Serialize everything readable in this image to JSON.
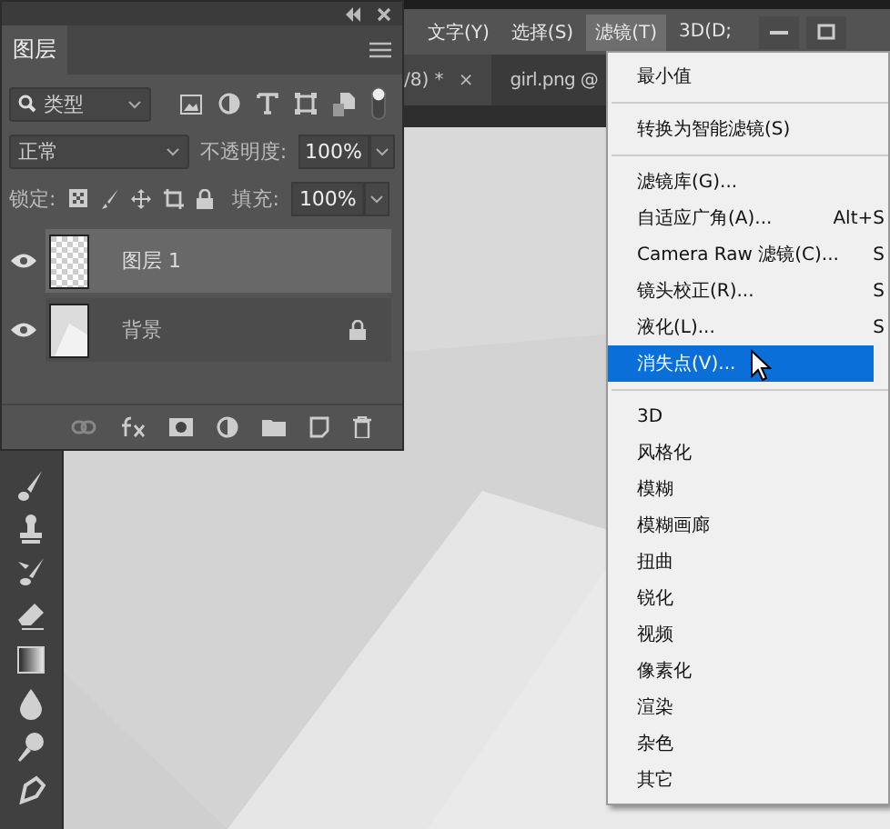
{
  "menubar": {
    "items": [
      {
        "label": "文字(Y)",
        "selected": false
      },
      {
        "label": "选择(S)",
        "selected": false
      },
      {
        "label": "滤镜(T)",
        "selected": true
      },
      {
        "label": "3D(D;",
        "selected": false
      }
    ]
  },
  "tabs": [
    {
      "label": "/8) *",
      "close": "×"
    },
    {
      "label": "girl.png @"
    }
  ],
  "layers_panel": {
    "title": "图层",
    "filter": {
      "value": "类型"
    },
    "blend_mode": {
      "value": "正常"
    },
    "opacity": {
      "label": "不透明度:",
      "value": "100%"
    },
    "lock_label": "锁定:",
    "fill": {
      "label": "填充:",
      "value": "100%"
    },
    "layers": [
      {
        "name": "图层 1",
        "selected": true,
        "visible": true,
        "locked": false,
        "kind": "transparent"
      },
      {
        "name": "背景",
        "selected": false,
        "visible": true,
        "locked": true,
        "kind": "background"
      }
    ]
  },
  "filter_menu": {
    "items": [
      {
        "kind": "item",
        "label": "最小值",
        "selected": false
      },
      {
        "kind": "separator"
      },
      {
        "kind": "item",
        "label": "转换为智能滤镜(S)",
        "selected": false
      },
      {
        "kind": "separator"
      },
      {
        "kind": "item",
        "label": "滤镜库(G)...",
        "selected": false
      },
      {
        "kind": "item",
        "label": "自适应广角(A)...",
        "shortcut": "Alt+S",
        "selected": false
      },
      {
        "kind": "item",
        "label": "Camera Raw 滤镜(C)...",
        "shortcut": "S",
        "selected": false
      },
      {
        "kind": "item",
        "label": "镜头校正(R)...",
        "shortcut": "S",
        "selected": false
      },
      {
        "kind": "item",
        "label": "液化(L)...",
        "shortcut": "S",
        "selected": false
      },
      {
        "kind": "item",
        "label": "消失点(V)...",
        "selected": true
      },
      {
        "kind": "separator"
      },
      {
        "kind": "item",
        "label": "3D",
        "selected": false
      },
      {
        "kind": "item",
        "label": "风格化",
        "selected": false
      },
      {
        "kind": "item",
        "label": "模糊",
        "selected": false
      },
      {
        "kind": "item",
        "label": "模糊画廊",
        "selected": false
      },
      {
        "kind": "item",
        "label": "扭曲",
        "selected": false
      },
      {
        "kind": "item",
        "label": "锐化",
        "selected": false
      },
      {
        "kind": "item",
        "label": "视频",
        "selected": false
      },
      {
        "kind": "item",
        "label": "像素化",
        "selected": false
      },
      {
        "kind": "item",
        "label": "渲染",
        "selected": false
      },
      {
        "kind": "item",
        "label": "杂色",
        "selected": false
      },
      {
        "kind": "item",
        "label": "其它",
        "selected": false
      }
    ]
  }
}
